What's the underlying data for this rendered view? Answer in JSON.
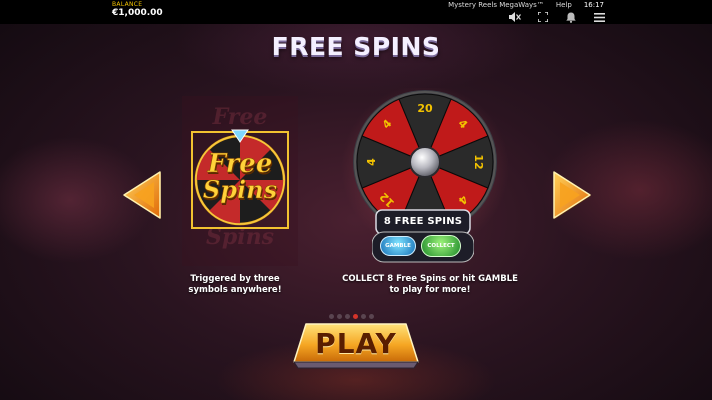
{
  "topbar": {
    "balance_label": "BALANCE",
    "balance_value": "€1,000.00",
    "game_name": "Mystery Reels MegaWays™",
    "help": "Help",
    "clock": "16:17",
    "icons": [
      "mute-icon",
      "fullscreen-icon",
      "notification-icon",
      "menu-icon"
    ]
  },
  "screen": {
    "title": "FREE SPINS",
    "left_caption_line1": "Triggered by three",
    "left_caption_line2": "symbols anywhere!",
    "right_caption_line1": "COLLECT 8 Free Spins or hit GAMBLE",
    "right_caption_line2": "to play for more!",
    "free_spins_logo_line1": "Free",
    "free_spins_logo_line2": "Spins",
    "badge": "8 FREE SPINS",
    "gamble_label": "GAMBLE",
    "collect_label": "COLLECT",
    "wheel_numbers": [
      "20",
      "4",
      "12",
      "4",
      "4",
      "12",
      "4",
      "4"
    ],
    "pagination": {
      "total": 6,
      "active": 4
    },
    "play_label": "PLAY"
  },
  "colors": {
    "accent_gold": "#f2c200",
    "active_dot": "#d4342a",
    "wheel_red": "#c01a1a",
    "wheel_dark": "#2a2a2a"
  }
}
